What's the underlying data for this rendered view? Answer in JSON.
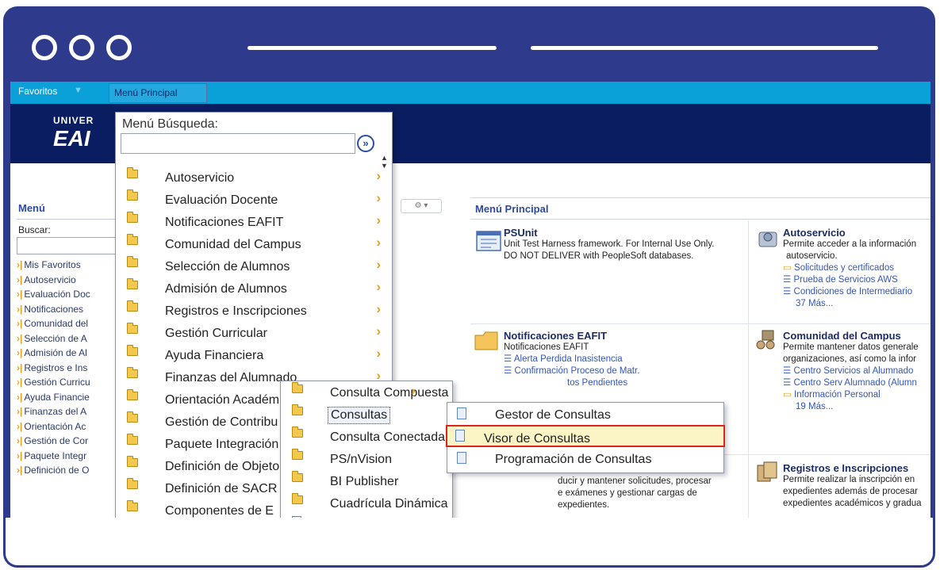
{
  "menubar": {
    "favoritos": "Favoritos",
    "menu_principal": "Menú Principal"
  },
  "banner": {
    "logo_small": "UNIVER",
    "logo_big": "EAI"
  },
  "left_panel": {
    "title": "Menú",
    "search_label": "Buscar:",
    "items": [
      "Mis Favoritos",
      "Autoservicio",
      "Evaluación Doc",
      "Notificaciones",
      "Comunidad del",
      "Selección de A",
      "Admisión de Al",
      "Registros e Ins",
      "Gestión Curricu",
      "Ayuda Financie",
      "Finanzas del A",
      "Orientación Ac",
      "Gestión de Cor",
      "Paquete Integr",
      "Definición de O"
    ]
  },
  "main_panel": {
    "title": "Menú Principal",
    "tiles": {
      "psunit": {
        "title": "PSUnit",
        "desc1": "Unit Test Harness framework. For Internal Use Only.",
        "desc2": "DO NOT DELIVER with PeopleSoft databases."
      },
      "autoservicio": {
        "title": "Autoservicio",
        "desc1": "Permite acceder a la información",
        "desc2": "autoservicio.",
        "links": [
          "Solicitudes y certificados",
          "Prueba de Servicios AWS",
          "Condiciones de Intermediario"
        ],
        "more": "37 Más..."
      },
      "notificaciones": {
        "title": "Notificaciones EAFIT",
        "desc1": "Notificaciones EAFIT",
        "links": [
          "Alerta Perdida Inasistencia",
          "Confirmación Proceso de Matr.",
          "tos Pendientes"
        ]
      },
      "comunidad": {
        "title": "Comunidad del Campus",
        "desc1": "Permite mantener datos generale",
        "desc2": "organizaciones, así como la infor",
        "links": [
          "Centro Servicios al Alumnado",
          "Centro Serv Alumnado (Alumn",
          "Información Personal"
        ],
        "more": "19 Más..."
      },
      "registros_partial": {
        "line1": "ducir y mantener solicitudes, procesar",
        "line2": "e exámenes y gestionar cargas de",
        "line3": "expedientes."
      },
      "registros": {
        "title": "Registros e Inscripciones",
        "desc1": "Permite realizar la inscripción en",
        "desc2": "expedientes además de procesar",
        "desc3": "expedientes académicos y gradua"
      }
    }
  },
  "dropdown1": {
    "search_label": "Menú Búsqueda:",
    "search_value": "",
    "go": "»",
    "items": [
      "Autoservicio",
      "Evaluación Docente",
      "Notificaciones EAFIT",
      "Comunidad del Campus",
      "Selección de Alumnos",
      "Admisión de Alumnos",
      "Registros e Inscripciones",
      "Gestión Curricular",
      "Ayuda Financiera",
      "Finanzas del Alumnado",
      "Orientación Académ",
      "Gestión de Contribu",
      "Paquete Integración",
      "Definición de Objeto",
      "Definición de SACR",
      "Componentes de E"
    ]
  },
  "dropdown2": {
    "items": [
      "Consulta Compuesta",
      "Consultas",
      "Consulta Conectada",
      "PS/nVision",
      "BI Publisher",
      "Cuadrícula Dinámica"
    ]
  },
  "dropdown3": {
    "items": [
      "Gestor de Consultas",
      "Visor de Consultas",
      "Programación de Consultas"
    ]
  }
}
